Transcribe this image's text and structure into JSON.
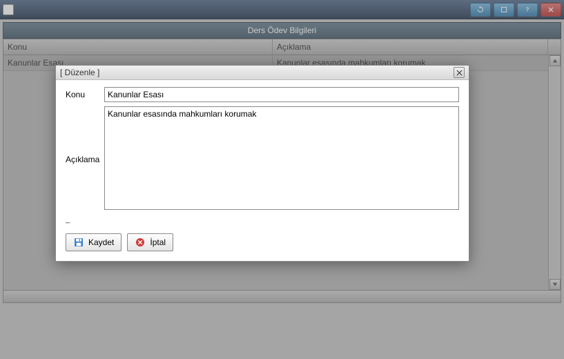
{
  "window": {
    "title": ""
  },
  "panel": {
    "title": "Ders Ödev Bilgileri"
  },
  "grid": {
    "headers": {
      "konu": "Konu",
      "aciklama": "Açıklama"
    },
    "rows": [
      {
        "konu": "Kanunlar Esası",
        "aciklama": "Kanunlar esasında mahkumları korumak"
      }
    ]
  },
  "dialog": {
    "title": "[ Düzenle ]",
    "labels": {
      "konu": "Konu",
      "aciklama": "Açıklama"
    },
    "values": {
      "konu": "Kanunlar Esası",
      "aciklama": "Kanunlar esasında mahkumları korumak"
    },
    "status": "_",
    "buttons": {
      "save": "Kaydet",
      "cancel": "İptal"
    }
  }
}
